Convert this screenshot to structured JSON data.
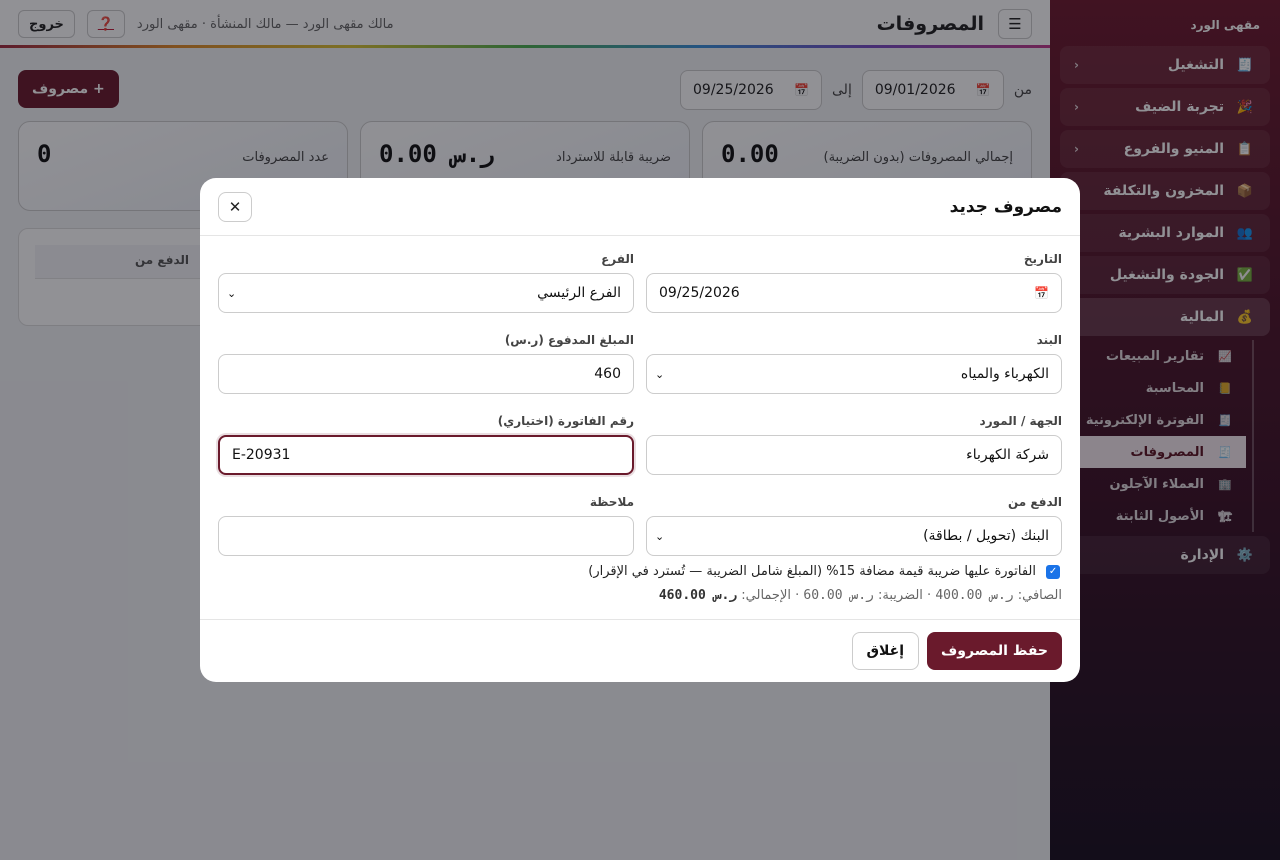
{
  "sidebar": {
    "brand": "مقهى الورد",
    "groups": [
      {
        "label": "التشغيل",
        "icon": "🧾",
        "chevron": "‹"
      },
      {
        "label": "تجربة الضيف",
        "icon": "🎉",
        "chevron": "‹"
      },
      {
        "label": "المنيو والفروع",
        "icon": "📋",
        "chevron": "‹"
      },
      {
        "label": "المخزون والتكلفة",
        "icon": "📦"
      },
      {
        "label": "الموارد البشرية",
        "icon": "👥"
      },
      {
        "label": "الجودة والتشغيل",
        "icon": "✅"
      },
      {
        "label": "المالية",
        "icon": "💰"
      }
    ],
    "finance_items": [
      {
        "label": "تقارير المبيعات",
        "icon": "📈"
      },
      {
        "label": "المحاسبة",
        "icon": "📒"
      },
      {
        "label": "الفوترة الإلكترونية",
        "icon": "🧾"
      },
      {
        "label": "المصروفات",
        "icon": "🧾"
      },
      {
        "label": "العملاء الآجلون",
        "icon": "🏢"
      },
      {
        "label": "الأصول الثابتة",
        "icon": "🏗"
      }
    ],
    "admin": {
      "label": "الإدارة",
      "icon": "⚙️"
    }
  },
  "header": {
    "menu_icon": "☰",
    "title": "المصروفات",
    "user_info": "مالك مقهى الورد — مالك المنشأة · مقهى الورد",
    "help_label": "❓",
    "logout_label": "خروج"
  },
  "filters": {
    "from_label": "من",
    "from_date": "09/01/2026",
    "to_label": "إلى",
    "to_date": "09/25/2026",
    "calendar_icon": "📅"
  },
  "add_button": "+ مصروف",
  "stats": [
    {
      "label": "إجمالي المصروفات (بدون الضريبة)",
      "value": "0.00"
    },
    {
      "label": "ضريبة قابلة للاسترداد",
      "value": "ر.س 0.00"
    },
    {
      "label": "عدد المصروفات",
      "value": "0"
    }
  ],
  "table": {
    "header_paid_from": "الدفع من"
  },
  "modal": {
    "title": "مصروف جديد",
    "close_icon": "✕",
    "date_label": "التاريخ",
    "date_value": "09/25/2026",
    "branch_label": "الفرع",
    "branch_value": "الفرع الرئيسي",
    "category_label": "البند",
    "category_value": "الكهرباء والمياه",
    "amount_label": "المبلغ المدفوع (ر.س)",
    "amount_value": "460",
    "vendor_label": "الجهة / المورد",
    "vendor_value": "شركة الكهرباء",
    "invoice_label": "رقم الفاتورة (اختياري)",
    "invoice_value": "E-20931",
    "paid_from_label": "الدفع من",
    "paid_from_value": "البنك (تحويل / بطاقة)",
    "note_label": "ملاحظة",
    "note_value": "",
    "vat_checkbox_label": "الفاتورة عليها ضريبة قيمة مضافة 15% (المبلغ شامل الضريبة — تُسترد في الإقرار)",
    "vat_checked": true,
    "summary": {
      "net_label": "الصافي:",
      "net_value": "ر.س 400.00",
      "tax_label": "الضريبة:",
      "tax_value": "ر.س 60.00",
      "total_label": "الإجمالي:",
      "total_value": "ر.س 460.00"
    },
    "save_label": "حفظ المصروف",
    "close_label": "إغلاق"
  },
  "colors": {
    "brand": "#6a1a2c",
    "sidebar_top": "#6d1a2e",
    "sidebar_bottom": "#1a1020"
  }
}
